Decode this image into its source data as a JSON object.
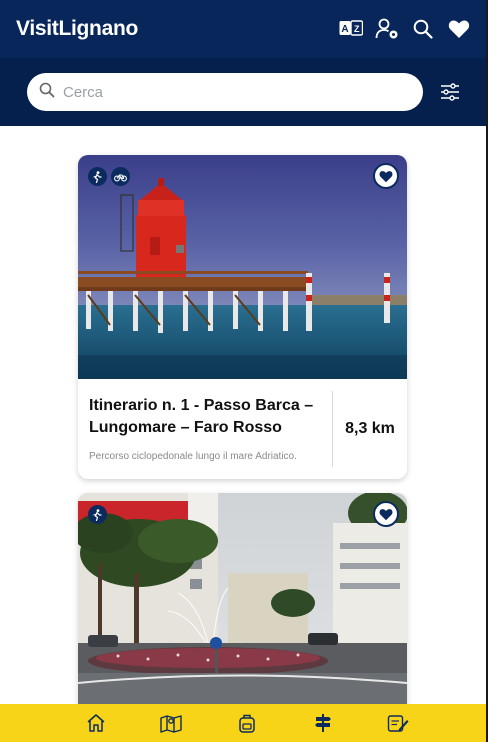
{
  "header": {
    "brand": "VisitLignano",
    "icons": [
      "translate-icon",
      "user-settings-icon",
      "search-icon",
      "heart-icon"
    ]
  },
  "search": {
    "placeholder": "Cerca",
    "filter_icon": "filter-sliders-icon"
  },
  "cards": [
    {
      "title": "Itinerario n. 1 - Passo Barca – Lungomare – Faro Rosso",
      "description": "Percorso ciclopedonale lungo il mare Adriatico.",
      "distance": "8,3 km",
      "badges": [
        "walking-icon",
        "bike-icon"
      ],
      "favorite_icon": "heart-icon"
    },
    {
      "badges": [
        "walking-icon"
      ],
      "favorite_icon": "heart-icon"
    }
  ],
  "bottom_nav": [
    "home-icon",
    "map-icon",
    "backpack-icon",
    "signpost-icon",
    "notes-icon"
  ],
  "colors": {
    "navy": "#08265a",
    "yellow": "#f7d417"
  }
}
